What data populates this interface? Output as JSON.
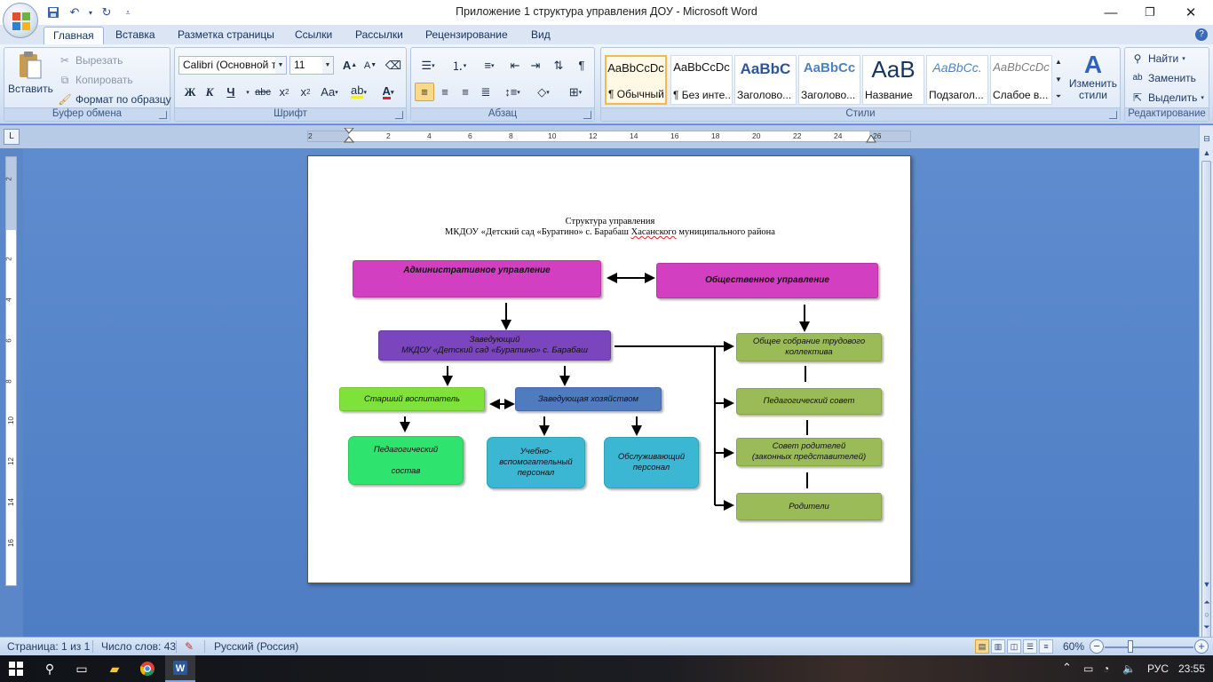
{
  "window": {
    "title": "Приложение 1 структура управления ДОУ - Microsoft Word",
    "minimize": "—",
    "restore": "❐",
    "close": "✕"
  },
  "qat": {
    "save_icon": "save-icon",
    "undo_icon": "undo-icon",
    "redo_icon": "redo-icon",
    "customize_icon": "customize-icon"
  },
  "tabs": [
    "Главная",
    "Вставка",
    "Разметка страницы",
    "Ссылки",
    "Рассылки",
    "Рецензирование",
    "Вид"
  ],
  "ribbon": {
    "clipboard": {
      "label": "Буфер обмена",
      "paste": "Вставить",
      "cut": "Вырезать",
      "copy": "Копировать",
      "format_painter": "Формат по образцу"
    },
    "font": {
      "label": "Шрифт",
      "font_name": "Calibri (Основной те",
      "font_size": "11"
    },
    "paragraph": {
      "label": "Абзац"
    },
    "styles": {
      "label": "Стили",
      "items": [
        {
          "sample": "AaBbCcDc",
          "name": "¶ Обычный"
        },
        {
          "sample": "AaBbCcDc",
          "name": "¶ Без инте..."
        },
        {
          "sample": "AaBbC",
          "name": "Заголово..."
        },
        {
          "sample": "AaBbCc",
          "name": "Заголово..."
        },
        {
          "sample": "AaB",
          "name": "Название"
        },
        {
          "sample": "AaBbCc.",
          "name": "Подзагол..."
        },
        {
          "sample": "AaBbCcDc",
          "name": "Слабое в..."
        }
      ],
      "change_styles": "Изменить стили"
    },
    "editing": {
      "label": "Редактирование",
      "find": "Найти",
      "replace": "Заменить",
      "select": "Выделить"
    }
  },
  "ruler": {
    "h_numbers": [
      "2",
      "2",
      "4",
      "6",
      "8",
      "10",
      "12",
      "14",
      "16",
      "18",
      "20",
      "22",
      "24",
      "26"
    ],
    "v_numbers": [
      "2",
      "2",
      "4",
      "6",
      "8",
      "10",
      "12",
      "14",
      "16"
    ]
  },
  "document": {
    "title_line1": "Структура управления",
    "title_line2_a": "МКДОУ «Детский сад «Буратино» с. Барабаш ",
    "title_line2_b": "Хасанского",
    "title_line2_c": " муниципального района",
    "boxes": {
      "admin": "Административное управление",
      "public": "Общественное управление",
      "head": "Заведующий\nМКДОУ «Детский сад «Буратино» с. Барабаш",
      "senior_teacher": "Старший воспитатель",
      "housekeeping": "Заведующая хозяйством",
      "ped_staff": "Педагогический\n\nсостав",
      "support_staff": "Учебно-\nвспомогательный\nперсонал",
      "service_staff": "Обслуживающий\nперсонал",
      "general_meeting": "Общее собрание трудового\nколлектива",
      "ped_council": "Педагогический совет",
      "parent_council": "Совет родителей\n(законных представителей)",
      "parents": "Родители"
    },
    "colors": {
      "magenta": "#d23fc0",
      "purple": "#7a45bd",
      "green_light": "#7fe23a",
      "steel_blue": "#4f7cbf",
      "green_bright": "#2ee46e",
      "cyan": "#3bb6d3",
      "olive": "#9bbb59"
    }
  },
  "status": {
    "page": "Страница: 1 из 1",
    "words": "Число слов: 43",
    "language": "Русский (Россия)",
    "zoom": "60%"
  },
  "taskbar": {
    "lang": "РУС",
    "time": "23:55"
  }
}
